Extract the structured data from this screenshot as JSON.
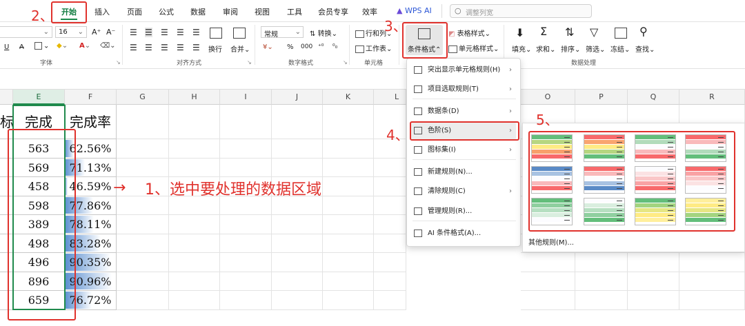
{
  "menubar": {
    "tabs": [
      "开始",
      "插入",
      "页面",
      "公式",
      "数据",
      "审阅",
      "视图",
      "工具",
      "会员专享",
      "效率",
      "WPS AI"
    ],
    "search_placeholder": "调整列宽"
  },
  "ribbon": {
    "font_size": "16",
    "font_group": "字体",
    "align_group": "对齐方式",
    "wrap": "换行",
    "merge": "合并",
    "number_format": "常规",
    "convert": "转换",
    "number_group": "数字格式",
    "row_col": "行和列",
    "worksheet": "工作表",
    "cell_group": "单元格",
    "table_style": "表格样式",
    "cell_style": "单元格样式",
    "cond_format": "条件格式",
    "fill": "填充",
    "sum": "求和",
    "sort": "排序",
    "filter": "筛选",
    "freeze": "冻结",
    "find": "查找",
    "data_group": "数据处理"
  },
  "grid": {
    "columns": [
      "E",
      "F",
      "G",
      "H",
      "I",
      "J",
      "K",
      "L",
      "O",
      "P",
      "Q",
      "R"
    ],
    "header_e": "完成",
    "header_f": "完成率",
    "partial_left": "标",
    "rows": [
      {
        "done": "563",
        "rate": "62.56%",
        "bar": 0.17
      },
      {
        "done": "569",
        "rate": "71.13%",
        "bar": 0.38
      },
      {
        "done": "458",
        "rate": "46.59%",
        "bar": 0.05
      },
      {
        "done": "598",
        "rate": "77.86%",
        "bar": 0.55
      },
      {
        "done": "389",
        "rate": "78.11%",
        "bar": 0.56
      },
      {
        "done": "498",
        "rate": "83.28%",
        "bar": 0.69
      },
      {
        "done": "496",
        "rate": "90.35%",
        "bar": 0.88
      },
      {
        "done": "896",
        "rate": "90.96%",
        "bar": 0.9
      },
      {
        "done": "659",
        "rate": "76.72%",
        "bar": 0.52
      }
    ]
  },
  "dropdown": {
    "items": [
      {
        "label": "突出显示单元格规则(H)",
        "arrow": true
      },
      {
        "label": "项目选取规则(T)",
        "arrow": true
      },
      {
        "label": "数据条(D)",
        "arrow": true
      },
      {
        "label": "色阶(S)",
        "arrow": true
      },
      {
        "label": "图标集(I)",
        "arrow": true
      },
      {
        "label": "新建规则(N)...",
        "arrow": false
      },
      {
        "label": "清除规则(C)",
        "arrow": true
      },
      {
        "label": "管理规则(R)...",
        "arrow": false
      },
      {
        "label": "AI 条件格式(A)...",
        "arrow": false
      }
    ]
  },
  "panel": {
    "more_rules": "其他规则(M)...",
    "scales": [
      [
        "#63be7b",
        "#b6d680",
        "#ffeb84",
        "#f8a06c",
        "#f8696b"
      ],
      [
        "#f8696b",
        "#f9a46f",
        "#ffeb84",
        "#b6d680",
        "#63be7b"
      ],
      [
        "#63be7b",
        "#b1dbbb",
        "#fcfcff",
        "#f9b9bb",
        "#f8696b"
      ],
      [
        "#f8696b",
        "#f9b9bb",
        "#fcfcff",
        "#b1dbbb",
        "#63be7b"
      ],
      [
        "#5a8ac6",
        "#a8c2e2",
        "#fcfcff",
        "#f9b9bb",
        "#f8696b"
      ],
      [
        "#f8696b",
        "#f9b9bb",
        "#fcfcff",
        "#a8c2e2",
        "#5a8ac6"
      ],
      [
        "#fcfcff",
        "#fbe2e3",
        "#fac7c8",
        "#f9a2a4",
        "#f8696b"
      ],
      [
        "#f8696b",
        "#f9a2a4",
        "#fac7c8",
        "#fbe2e3",
        "#fcfcff"
      ],
      [
        "#63be7b",
        "#8fcf9f",
        "#b6dfc1",
        "#d9eedf",
        "#fcfcff"
      ],
      [
        "#fcfcff",
        "#d9eedf",
        "#b6dfc1",
        "#8fcf9f",
        "#63be7b"
      ],
      [
        "#63be7b",
        "#a3d47f",
        "#e6e683",
        "#ffeb84",
        "#ffef9c"
      ],
      [
        "#ffef9c",
        "#ffeb84",
        "#e6e683",
        "#a3d47f",
        "#63be7b"
      ]
    ]
  },
  "annotations": {
    "step1": "1、选中要处理的数据区域",
    "step2": "2、",
    "step3": "3、",
    "step4": "4、",
    "step5": "5、"
  },
  "colors": {
    "accent": "#1a8a4a",
    "annotation": "#e0312c",
    "databar": "#5b8fd0"
  }
}
